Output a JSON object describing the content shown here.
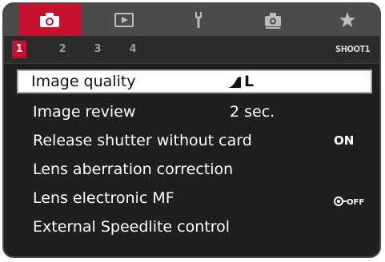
{
  "tabs": [
    {
      "icon": "camera-icon",
      "active": true
    },
    {
      "icon": "playback-icon",
      "active": false
    },
    {
      "icon": "wrench-icon",
      "active": false
    },
    {
      "icon": "custom-function-camera-icon",
      "active": false
    },
    {
      "icon": "star-icon",
      "active": false
    }
  ],
  "subtabs": {
    "items": [
      "1",
      "2",
      "3",
      "4"
    ],
    "active_index": 0,
    "page_label": "SHOOT1"
  },
  "menu": {
    "items": [
      {
        "label": "Image quality",
        "value": "L",
        "value_icon": "fine-quality-icon",
        "selected": true
      },
      {
        "label": "Image review",
        "value": "2 sec.",
        "selected": false
      },
      {
        "label": "Release shutter without card",
        "value": "ON",
        "selected": false
      },
      {
        "label": "Lens aberration correction",
        "value": "",
        "selected": false
      },
      {
        "label": "Lens electronic MF",
        "value": "OFF",
        "value_icon": "lens-mf-icon",
        "selected": false
      },
      {
        "label": "External Speedlite control",
        "value": "",
        "selected": false
      }
    ]
  },
  "colors": {
    "accent": "#c8102e",
    "background": "#1f1f1f",
    "tabbar": "#4b4b4b",
    "selected_row": "#ffffff"
  }
}
